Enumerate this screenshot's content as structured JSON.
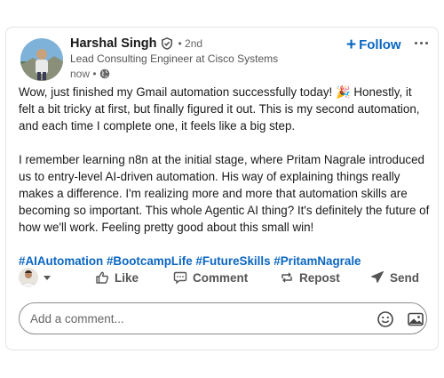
{
  "post": {
    "author": {
      "name": "Harshal Singh",
      "degree": "• 2nd",
      "headline": "Lead Consulting Engineer at Cisco Systems",
      "time": "now •"
    },
    "follow_label": "Follow",
    "body": {
      "para1": "Wow, just finished my Gmail automation successfully today! 🎉 Honestly, it felt a bit tricky at first, but finally figured it out. This is my second automation, and each time I complete one, it feels like a big step.",
      "para2": "I remember learning n8n at the initial stage, where Pritam Nagrale introduced us to entry-level AI-driven automation. His way of explaining things really makes a difference. I'm realizing more and more that automation skills are becoming so important. This whole Agentic AI thing? It's definitely the future of how we'll work. Feeling pretty good about this small win!"
    },
    "hashtags": [
      "#AIAutomation",
      "#BootcampLife",
      "#FutureSkills",
      "#PritamNagrale"
    ],
    "actions": {
      "like": "Like",
      "comment": "Comment",
      "repost": "Repost",
      "send": "Send"
    },
    "comment_box": {
      "placeholder": "Add a comment..."
    }
  },
  "colors": {
    "accent": "#0a66c2",
    "text": "#191919",
    "muted": "#666666"
  }
}
